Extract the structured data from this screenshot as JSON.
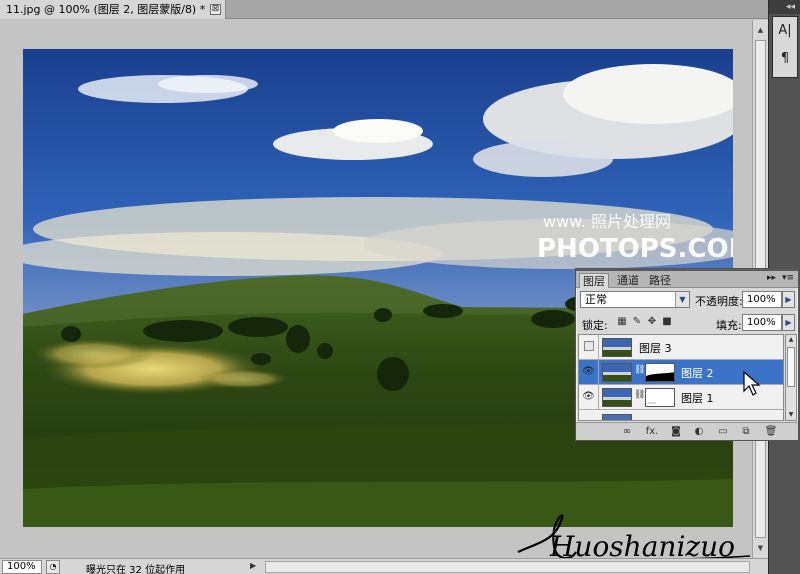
{
  "document": {
    "tab_title": "11.jpg @ 100% (图层 2, 图层蒙版/8) *",
    "close_glyph": "⊠"
  },
  "watermark": {
    "line1": "www.  照片处理网",
    "line2": "PHOTOPS.COM"
  },
  "signature_text": "Huoshanizuo",
  "right_dock": {
    "buttons": [
      {
        "icon": "character-icon",
        "glyph": "A|"
      },
      {
        "icon": "paragraph-icon",
        "glyph": "¶"
      }
    ],
    "collapse_glyph": "◂◂"
  },
  "layers_panel": {
    "tabs": [
      "图层",
      "通道",
      "路径"
    ],
    "active_tab": "图层",
    "blend_mode": "正常",
    "opacity_label": "不透明度:",
    "opacity_value": "100%",
    "lock_label": "锁定:",
    "fill_label": "填充:",
    "fill_value": "100%",
    "layers": [
      {
        "name": "图层 3",
        "visible": false,
        "has_mask": false,
        "selected": false
      },
      {
        "name": "图层 2",
        "visible": true,
        "has_mask": true,
        "selected": true
      },
      {
        "name": "图层 1",
        "visible": true,
        "has_mask": true,
        "selected": false
      }
    ],
    "footer_icons": [
      "link-layers-icon",
      "fx-icon",
      "add-mask-icon",
      "adjustment-icon",
      "group-icon",
      "new-layer-icon",
      "trash-icon"
    ],
    "footer_fx_label": "fx."
  },
  "status_bar": {
    "zoom": "100%",
    "info": "曝光只在 32 位起作用"
  }
}
